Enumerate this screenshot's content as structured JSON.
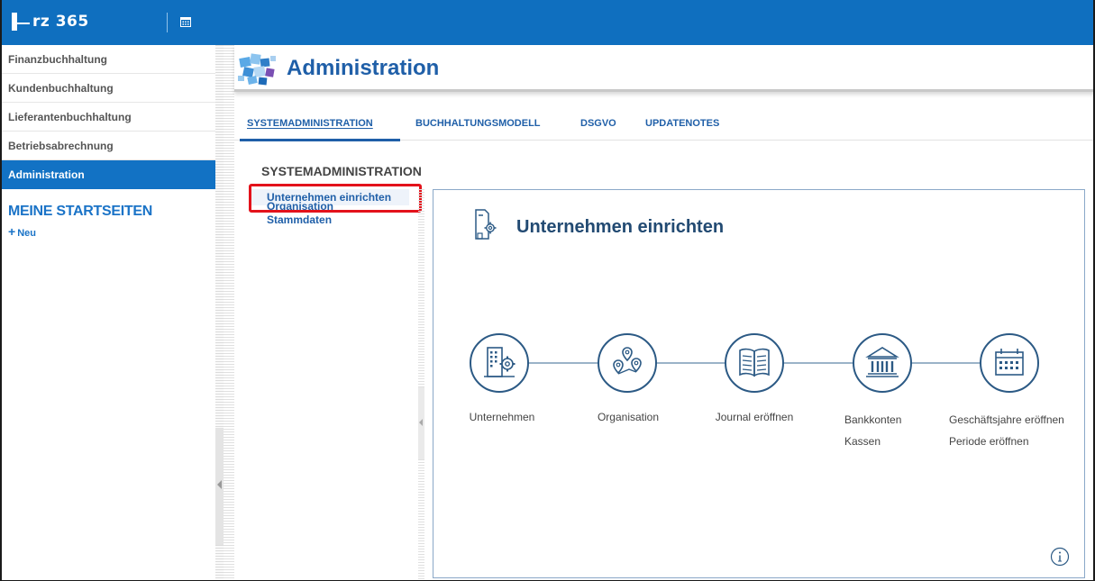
{
  "app": {
    "logo_text": "rz 365",
    "primary_color": "#0f6fbf",
    "highlight_color": "#e3121b"
  },
  "sidebar": {
    "items": [
      {
        "label": "Finanzbuchhaltung",
        "active": false
      },
      {
        "label": "Kundenbuchhaltung",
        "active": false
      },
      {
        "label": "Lieferantenbuchhaltung",
        "active": false
      },
      {
        "label": "Betriebsabrechnung",
        "active": false
      },
      {
        "label": "Administration",
        "active": true
      }
    ],
    "startpages_title": "MEINE STARTSEITEN",
    "new_label": "Neu"
  },
  "header": {
    "title": "Administration",
    "icon": "puzzle-pieces-icon"
  },
  "tabs": [
    {
      "label": "SYSTEMADMINISTRATION",
      "active": true
    },
    {
      "label": "BUCHHALTUNGSMODELL",
      "active": false
    },
    {
      "label": "DSGVO",
      "active": false
    },
    {
      "label": "UPDATENOTES",
      "active": false
    }
  ],
  "section": {
    "title": "SYSTEMADMINISTRATION",
    "subnav": [
      {
        "label": "Unternehmen einrichten",
        "selected": true
      },
      {
        "label": "Organisation",
        "selected": false
      },
      {
        "label": "Stammdaten",
        "selected": false
      }
    ]
  },
  "panel": {
    "title": "Unternehmen einrichten",
    "steps": [
      {
        "icon": "building-gear-icon",
        "label_lines": [
          "Unternehmen"
        ]
      },
      {
        "icon": "map-pins-icon",
        "label_lines": [
          "Organisation"
        ]
      },
      {
        "icon": "open-book-icon",
        "label_lines": [
          "Journal eröffnen"
        ]
      },
      {
        "icon": "bank-icon",
        "label_lines": [
          "Bankkonten",
          "Kassen"
        ]
      },
      {
        "icon": "calendar-icon",
        "label_lines": [
          "Geschäftsjahre eröffnen",
          "Periode eröffnen"
        ]
      }
    ]
  }
}
